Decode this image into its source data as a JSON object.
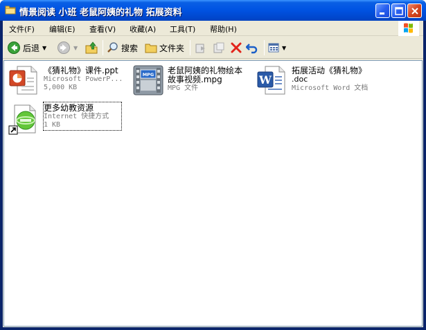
{
  "window": {
    "title": "情景阅读 小班 老鼠阿姨的礼物 拓展资料"
  },
  "menu": {
    "items": [
      "文件(F)",
      "编辑(E)",
      "查看(V)",
      "收藏(A)",
      "工具(T)",
      "帮助(H)"
    ]
  },
  "toolbar": {
    "back_label": "后退",
    "search_label": "搜索",
    "folders_label": "文件夹"
  },
  "files": [
    {
      "name": "《猜礼物》课件.ppt",
      "type": "Microsoft PowerP...",
      "size": "5,000 KB",
      "icon": "powerpoint-icon"
    },
    {
      "name_line1": "老鼠阿姨的礼物绘本",
      "name_line2": "故事视频.mpg",
      "type": "MPG 文件",
      "icon": "mpg-video-icon"
    },
    {
      "name_line1": "拓展活动《猜礼物》",
      "name_line2": ".doc",
      "type": "Microsoft Word 文档",
      "icon": "word-doc-icon"
    },
    {
      "name": "更多幼教资源",
      "type": "Internet 快捷方式",
      "size": "1 KB",
      "icon": "internet-shortcut-icon"
    }
  ],
  "colors": {
    "titlebar": "#0054e3",
    "chrome": "#ece9d8",
    "close_button": "#d5461f"
  }
}
